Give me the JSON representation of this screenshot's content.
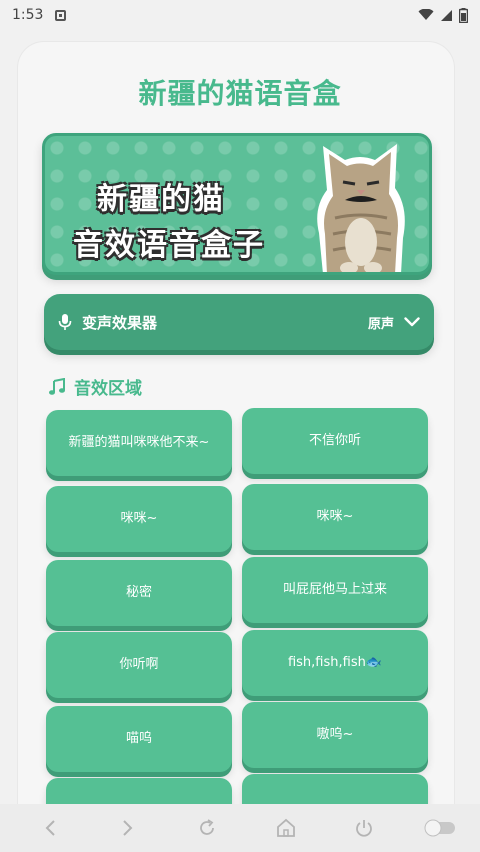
{
  "status_bar": {
    "time": "1:53"
  },
  "app": {
    "title": "新疆的猫语音盒"
  },
  "banner": {
    "line1": "新疆的猫",
    "line2": "音效语音盒子"
  },
  "voice_effect": {
    "label": "变声效果器",
    "value": "原声"
  },
  "section": {
    "title": "音效区域"
  },
  "sounds": [
    "新疆的猫叫咪咪他不来~",
    "不信你听",
    "咪咪~",
    "咪咪~",
    "秘密",
    "叫屁屁他马上过来",
    "你听啊",
    "fish,fish,fish🐟",
    "喵呜",
    "嗷呜~",
    "",
    ""
  ],
  "colors": {
    "accent": "#48b98d",
    "button": "#55c094",
    "button_shadow": "#3f9d78",
    "bar": "#43a27c"
  },
  "nav_icons": [
    "back-icon",
    "forward-icon",
    "refresh-icon",
    "home-icon",
    "power-icon",
    "toggle-icon"
  ]
}
